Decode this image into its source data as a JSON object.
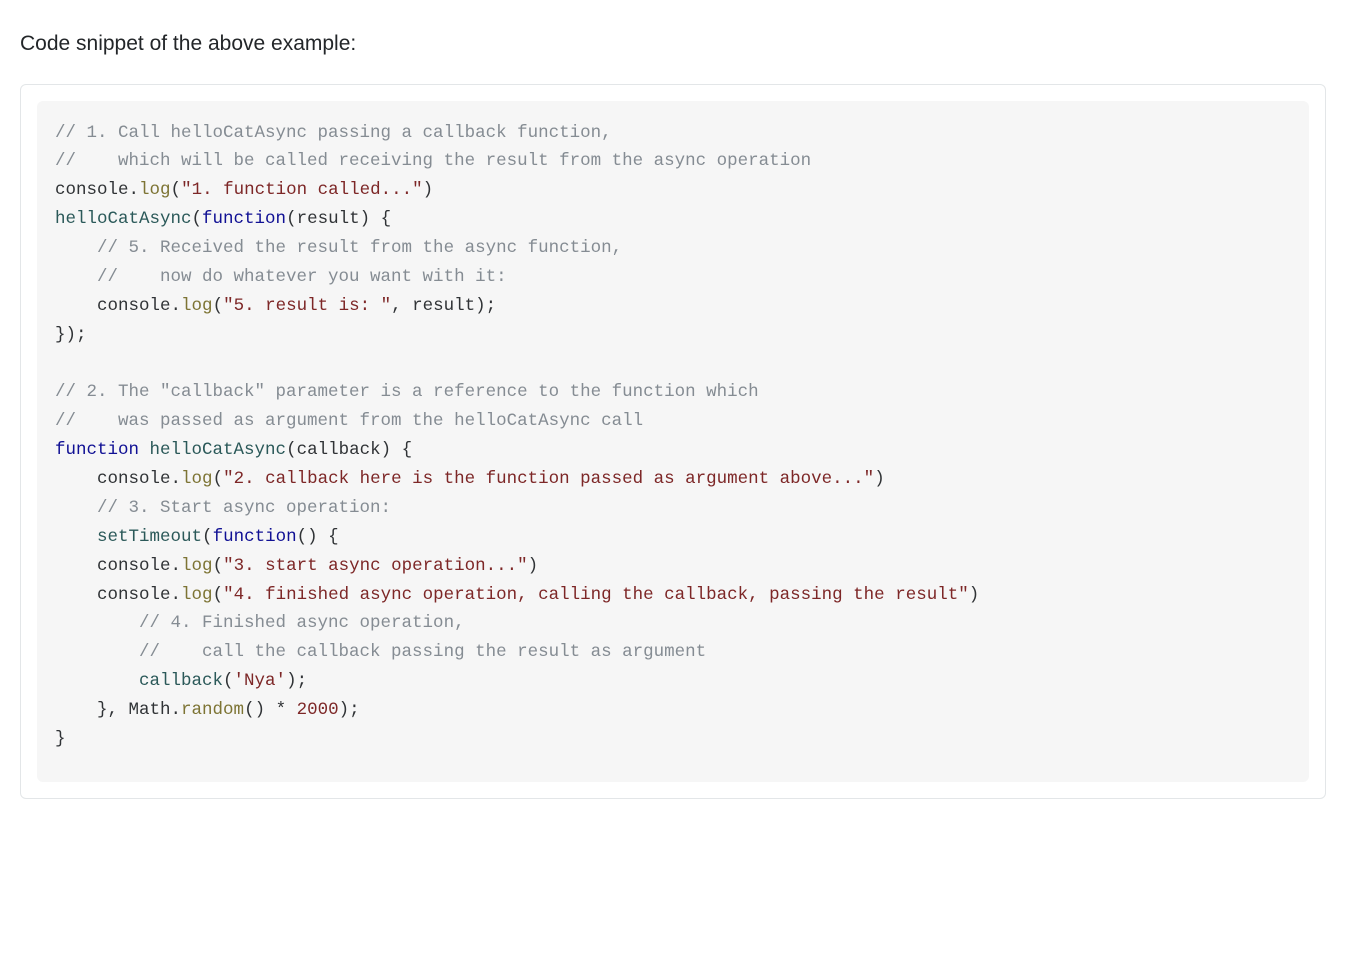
{
  "intro": "Code snippet of the above example:",
  "code": {
    "lines": [
      [
        {
          "cls": "tok-comment",
          "text": "// 1. Call helloCatAsync passing a callback function,"
        }
      ],
      [
        {
          "cls": "tok-comment",
          "text": "//    which will be called receiving the result from the async operation"
        }
      ],
      [
        {
          "cls": "tok-builtin",
          "text": "console"
        },
        {
          "cls": "tok-punct",
          "text": "."
        },
        {
          "cls": "tok-method",
          "text": "log"
        },
        {
          "cls": "tok-punct",
          "text": "("
        },
        {
          "cls": "tok-string",
          "text": "\"1. function called...\""
        },
        {
          "cls": "tok-punct",
          "text": ")"
        }
      ],
      [
        {
          "cls": "tok-funcname",
          "text": "helloCatAsync"
        },
        {
          "cls": "tok-punct",
          "text": "("
        },
        {
          "cls": "tok-keyword",
          "text": "function"
        },
        {
          "cls": "tok-punct",
          "text": "(result) {"
        }
      ],
      [
        {
          "cls": "tok-comment",
          "text": "    // 5. Received the result from the async function,"
        }
      ],
      [
        {
          "cls": "tok-comment",
          "text": "    //    now do whatever you want with it:"
        }
      ],
      [
        {
          "cls": "tok-ident",
          "text": "    "
        },
        {
          "cls": "tok-builtin",
          "text": "console"
        },
        {
          "cls": "tok-punct",
          "text": "."
        },
        {
          "cls": "tok-method",
          "text": "log"
        },
        {
          "cls": "tok-punct",
          "text": "("
        },
        {
          "cls": "tok-string",
          "text": "\"5. result is: \""
        },
        {
          "cls": "tok-punct",
          "text": ", result);"
        }
      ],
      [
        {
          "cls": "tok-punct",
          "text": "});"
        }
      ],
      [
        {
          "cls": "tok-ident",
          "text": ""
        }
      ],
      [
        {
          "cls": "tok-comment",
          "text": "// 2. The \"callback\" parameter is a reference to the function which"
        }
      ],
      [
        {
          "cls": "tok-comment",
          "text": "//    was passed as argument from the helloCatAsync call"
        }
      ],
      [
        {
          "cls": "tok-keyword",
          "text": "function"
        },
        {
          "cls": "tok-ident",
          "text": " "
        },
        {
          "cls": "tok-funcname",
          "text": "helloCatAsync"
        },
        {
          "cls": "tok-punct",
          "text": "(callback) {"
        }
      ],
      [
        {
          "cls": "tok-ident",
          "text": "    "
        },
        {
          "cls": "tok-builtin",
          "text": "console"
        },
        {
          "cls": "tok-punct",
          "text": "."
        },
        {
          "cls": "tok-method",
          "text": "log"
        },
        {
          "cls": "tok-punct",
          "text": "("
        },
        {
          "cls": "tok-string",
          "text": "\"2. callback here is the function passed as argument above...\""
        },
        {
          "cls": "tok-punct",
          "text": ")"
        }
      ],
      [
        {
          "cls": "tok-comment",
          "text": "    // 3. Start async operation:"
        }
      ],
      [
        {
          "cls": "tok-ident",
          "text": "    "
        },
        {
          "cls": "tok-funcname",
          "text": "setTimeout"
        },
        {
          "cls": "tok-punct",
          "text": "("
        },
        {
          "cls": "tok-keyword",
          "text": "function"
        },
        {
          "cls": "tok-punct",
          "text": "() {"
        }
      ],
      [
        {
          "cls": "tok-ident",
          "text": "    "
        },
        {
          "cls": "tok-builtin",
          "text": "console"
        },
        {
          "cls": "tok-punct",
          "text": "."
        },
        {
          "cls": "tok-method",
          "text": "log"
        },
        {
          "cls": "tok-punct",
          "text": "("
        },
        {
          "cls": "tok-string",
          "text": "\"3. start async operation...\""
        },
        {
          "cls": "tok-punct",
          "text": ")"
        }
      ],
      [
        {
          "cls": "tok-ident",
          "text": "    "
        },
        {
          "cls": "tok-builtin",
          "text": "console"
        },
        {
          "cls": "tok-punct",
          "text": "."
        },
        {
          "cls": "tok-method",
          "text": "log"
        },
        {
          "cls": "tok-punct",
          "text": "("
        },
        {
          "cls": "tok-string",
          "text": "\"4. finished async operation, calling the callback, passing the result\""
        },
        {
          "cls": "tok-punct",
          "text": ")"
        }
      ],
      [
        {
          "cls": "tok-comment",
          "text": "        // 4. Finished async operation,"
        }
      ],
      [
        {
          "cls": "tok-comment",
          "text": "        //    call the callback passing the result as argument"
        }
      ],
      [
        {
          "cls": "tok-ident",
          "text": "        "
        },
        {
          "cls": "tok-funcname",
          "text": "callback"
        },
        {
          "cls": "tok-punct",
          "text": "("
        },
        {
          "cls": "tok-string",
          "text": "'Nya'"
        },
        {
          "cls": "tok-punct",
          "text": ");"
        }
      ],
      [
        {
          "cls": "tok-ident",
          "text": "    }, "
        },
        {
          "cls": "tok-builtin",
          "text": "Math"
        },
        {
          "cls": "tok-punct",
          "text": "."
        },
        {
          "cls": "tok-method",
          "text": "random"
        },
        {
          "cls": "tok-punct",
          "text": "() * "
        },
        {
          "cls": "tok-number",
          "text": "2000"
        },
        {
          "cls": "tok-punct",
          "text": ");"
        }
      ],
      [
        {
          "cls": "tok-punct",
          "text": "}"
        }
      ]
    ]
  }
}
